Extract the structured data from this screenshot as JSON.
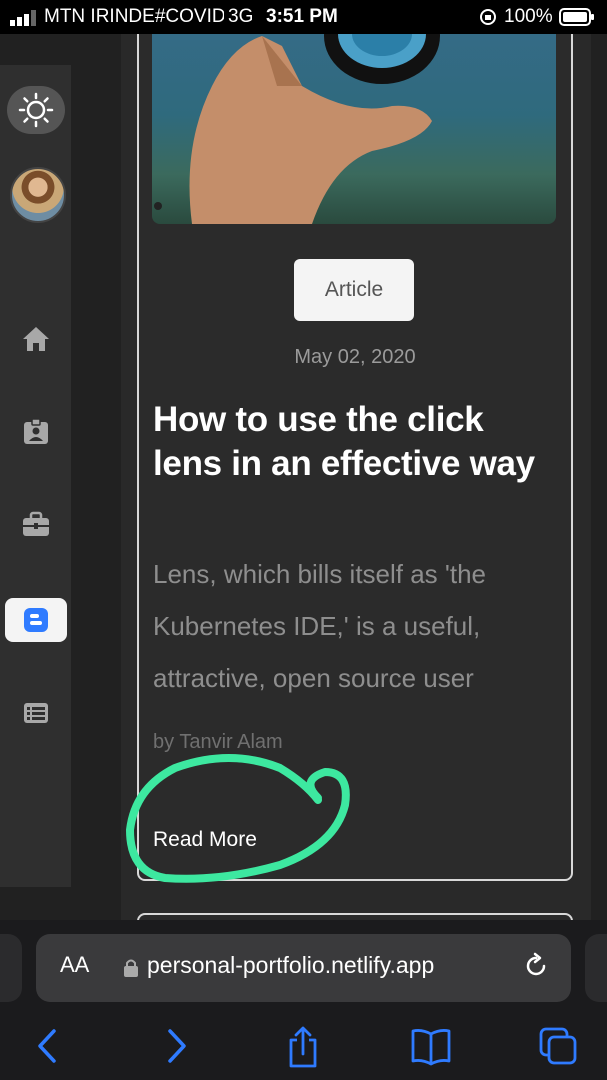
{
  "status_bar": {
    "carrier": "MTN IRINDE#COVID",
    "network": "3G",
    "time": "3:51 PM",
    "battery": "100%"
  },
  "sidebar": {
    "items": [
      {
        "icon": "sun-icon"
      },
      {
        "icon": "avatar"
      },
      {
        "icon": "home-icon"
      },
      {
        "icon": "id-badge-icon"
      },
      {
        "icon": "briefcase-icon"
      },
      {
        "icon": "blogger-icon",
        "active": true
      },
      {
        "icon": "list-icon"
      }
    ]
  },
  "post": {
    "tag": "Article",
    "date": "May 02, 2020",
    "title": "How to use the click lens in an effective way",
    "excerpt": "Lens, which bills itself as 'the Kubernetes IDE,' is a useful, attractive, open source user",
    "author": "by Tanvir Alam",
    "read_more": "Read More"
  },
  "browser": {
    "aa_label": "AA",
    "url": "personal-portfolio.netlify.app",
    "toolbar": [
      "back-icon",
      "forward-icon",
      "share-icon",
      "bookmarks-icon",
      "tabs-icon"
    ]
  },
  "colors": {
    "annotation": "#3de8a0",
    "accent_blue": "#2f7bff"
  }
}
